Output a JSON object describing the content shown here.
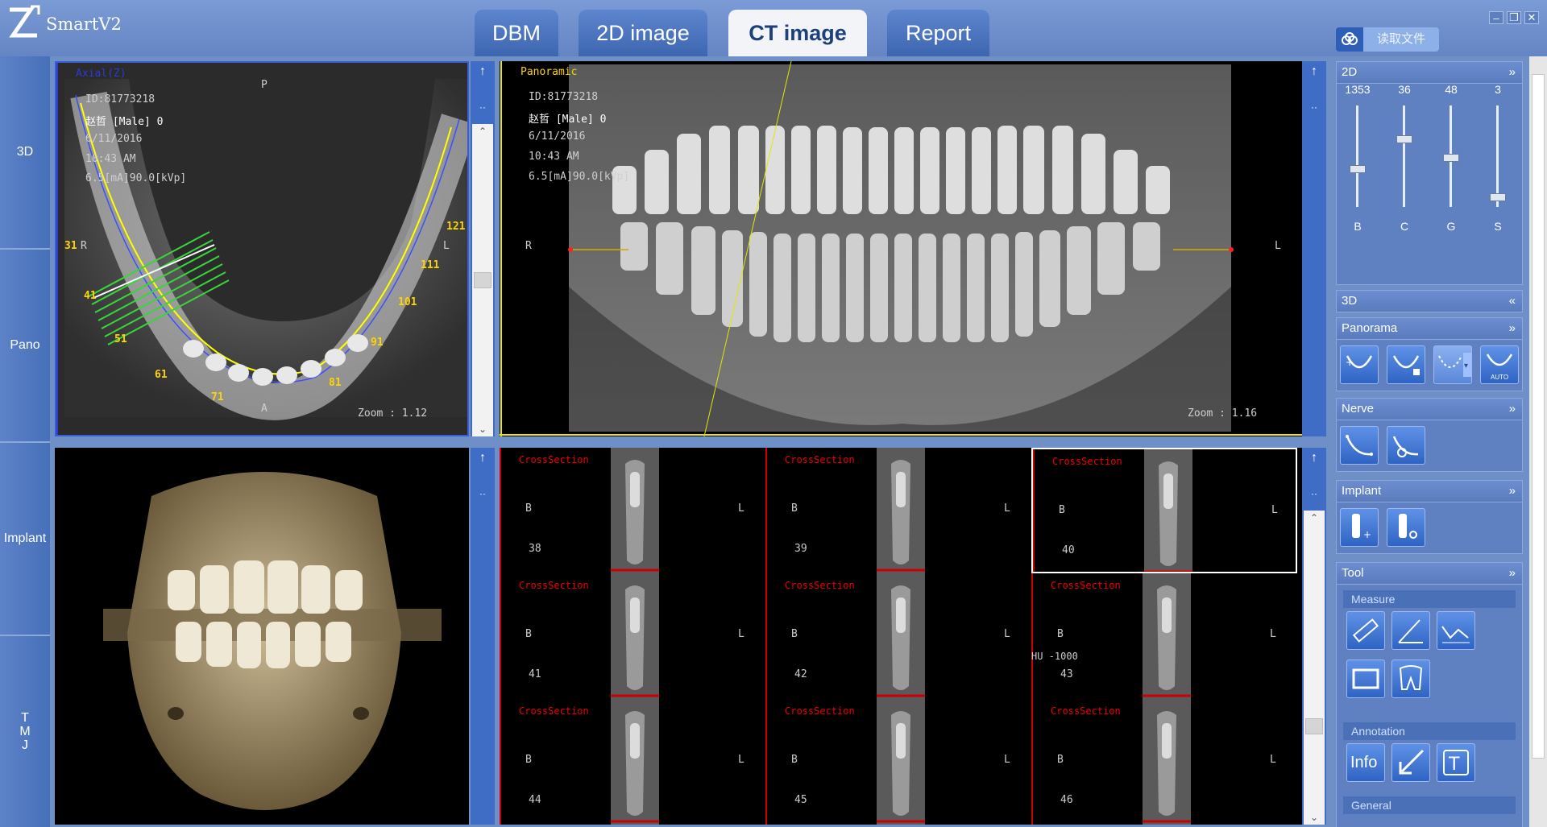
{
  "app": {
    "title": "SmartV2"
  },
  "tabs": [
    {
      "label": "DBM",
      "active": false
    },
    {
      "label": "2D image",
      "active": false
    },
    {
      "label": "CT image",
      "active": true
    },
    {
      "label": "Report",
      "active": false
    }
  ],
  "window_controls": {
    "minimize": "–",
    "restore": "❐",
    "close": "✕"
  },
  "read_file": {
    "label": "读取文件",
    "icon": "cloud-icon"
  },
  "sidenav": [
    {
      "label": "3D"
    },
    {
      "label": "Pano"
    },
    {
      "label": "Implant"
    },
    {
      "label": "T M J"
    }
  ],
  "axial": {
    "title": "Axial(Z)",
    "id": "ID:81773218",
    "patient": "赵哲 [Male] 0",
    "date": "6/11/2016",
    "time": "10:43 AM",
    "exposure": "6.5[mA]90.0[kVp]",
    "orient_top": "P",
    "orient_bottom": "A",
    "orient_left": "R",
    "orient_right": "L",
    "zoom": "Zoom : 1.12",
    "tooth_labels": [
      "31",
      "41",
      "51",
      "61",
      "71",
      "81",
      "91",
      "101",
      "111",
      "121"
    ]
  },
  "panoramic": {
    "title": "Panoramic",
    "id": "ID:81773218",
    "patient": "赵哲 [Male] 0",
    "date": "6/11/2016",
    "time": "10:43 AM",
    "exposure": "6.5[mA]90.0[kVp]",
    "orient_left": "R",
    "orient_right": "L",
    "zoom": "Zoom : 1.16"
  },
  "viewport_sidebar": {
    "expand": "↑",
    "dots": "··",
    "scroll_up": "⌃",
    "scroll_down": "⌄"
  },
  "cross_sections": [
    {
      "label": "CrossSection",
      "b": "B",
      "l": "L",
      "n": "38"
    },
    {
      "label": "CrossSection",
      "b": "B",
      "l": "L",
      "n": "39"
    },
    {
      "label": "CrossSection",
      "b": "B",
      "l": "L",
      "n": "40",
      "selected": true
    },
    {
      "label": "CrossSection",
      "b": "B",
      "l": "L",
      "n": "41"
    },
    {
      "label": "CrossSection",
      "b": "B",
      "l": "L",
      "n": "42"
    },
    {
      "label": "CrossSection",
      "b": "B",
      "l": "L",
      "n": "43",
      "hu": "HU -1000"
    },
    {
      "label": "CrossSection",
      "b": "B",
      "l": "L",
      "n": "44"
    },
    {
      "label": "CrossSection",
      "b": "B",
      "l": "L",
      "n": "45"
    },
    {
      "label": "CrossSection",
      "b": "B",
      "l": "L",
      "n": "46"
    }
  ],
  "panel": {
    "sec_2d": {
      "title": "2D",
      "chevron": "»",
      "sliders": [
        {
          "label": "B",
          "value": "1353",
          "level": 0.36
        },
        {
          "label": "C",
          "value": "36",
          "level": 0.68
        },
        {
          "label": "G",
          "value": "48",
          "level": 0.48
        },
        {
          "label": "S",
          "value": "3",
          "level": 0.06
        }
      ]
    },
    "sec_3d": {
      "title": "3D",
      "chevron": "«"
    },
    "sec_panorama": {
      "title": "Panorama",
      "chevron": "»",
      "auto_label": "AUTO"
    },
    "sec_nerve": {
      "title": "Nerve",
      "chevron": "»"
    },
    "sec_implant": {
      "title": "Implant",
      "chevron": "»"
    },
    "sec_tool": {
      "title": "Tool",
      "chevron": "»",
      "measure": "Measure",
      "annotation": "Annotation",
      "info_label": "Info",
      "general": "General"
    }
  },
  "colors": {
    "background": "#6f8fc7",
    "tab_active_text": "#1d3f7a",
    "crosssection_label": "#e00000",
    "axial_title": "#2a3bd6",
    "tooth_label": "#ffd400",
    "panoramic_title": "#ffd400"
  }
}
